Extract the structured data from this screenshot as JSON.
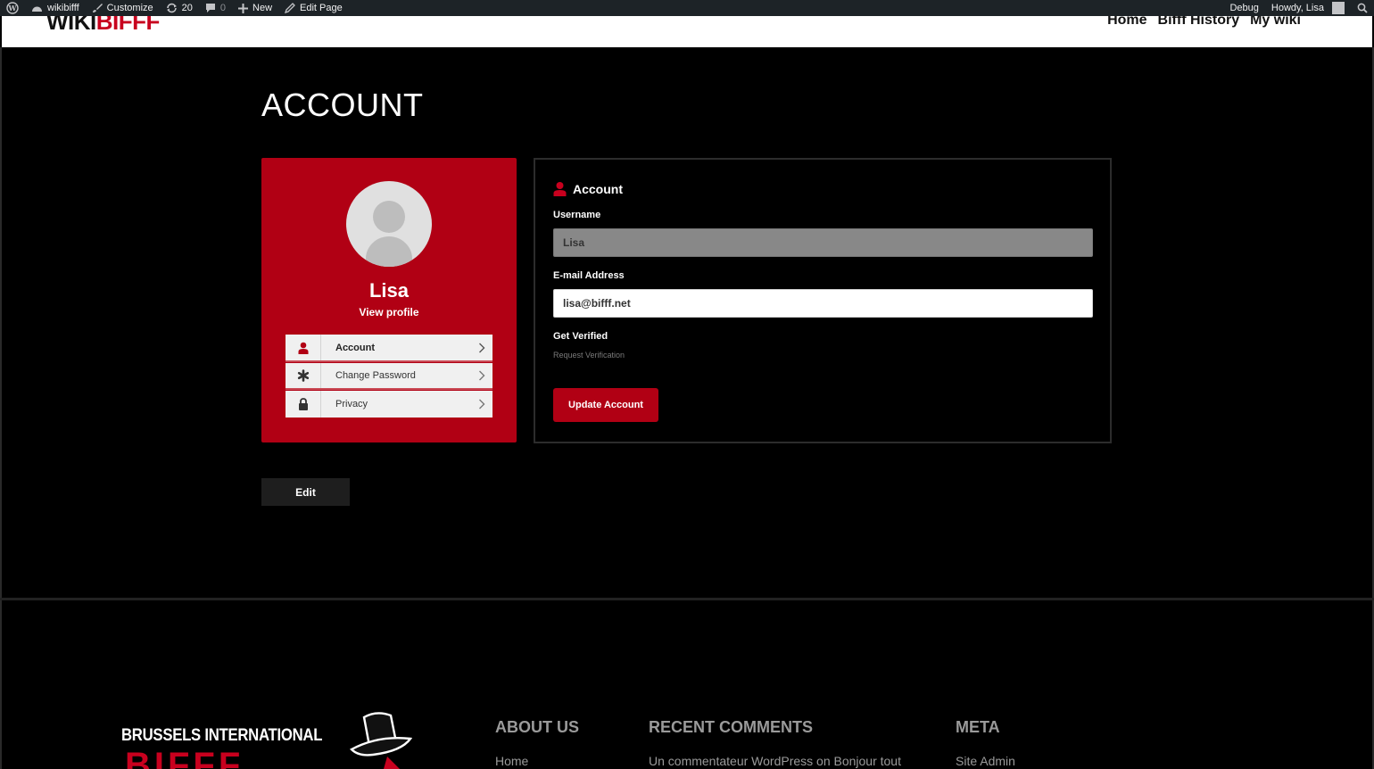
{
  "admin_bar": {
    "site_name": "wikibifff",
    "customize": "Customize",
    "updates_count": "20",
    "comments_count": "0",
    "new_label": "New",
    "edit_page": "Edit Page",
    "debug": "Debug",
    "howdy": "Howdy, Lisa"
  },
  "header": {
    "logo_wiki": "WIKI",
    "logo_bifff": "BIFFF",
    "nav": [
      "Home",
      "Bifff History",
      "My wiki"
    ]
  },
  "page": {
    "title": "ACCOUNT",
    "edit_label": "Edit"
  },
  "profile": {
    "name": "Lisa",
    "view_profile": "View profile",
    "menu": [
      {
        "label": "Account",
        "icon": "user-icon",
        "active": true
      },
      {
        "label": "Change Password",
        "icon": "asterisk-icon",
        "active": false
      },
      {
        "label": "Privacy",
        "icon": "lock-icon",
        "active": false
      }
    ]
  },
  "account": {
    "heading": "Account",
    "username_label": "Username",
    "username_value": "Lisa",
    "email_label": "E-mail Address",
    "email_value": "lisa@bifff.net",
    "verified_label": "Get Verified",
    "verify_link": "Request Verification",
    "update_button": "Update Account"
  },
  "footer": {
    "logo_line1": "BRUSSELS INTERNATIONAL",
    "logo_line2": "BIFFF",
    "columns": [
      {
        "title": "ABOUT US",
        "links": [
          "Home"
        ]
      },
      {
        "title": "RECENT COMMENTS",
        "links": [
          "Un commentateur WordPress on Bonjour tout"
        ]
      },
      {
        "title": "META",
        "links": [
          "Site Admin"
        ]
      }
    ]
  },
  "colors": {
    "accent": "#b10014",
    "admin_bar": "#1d2327",
    "background": "#000000"
  }
}
